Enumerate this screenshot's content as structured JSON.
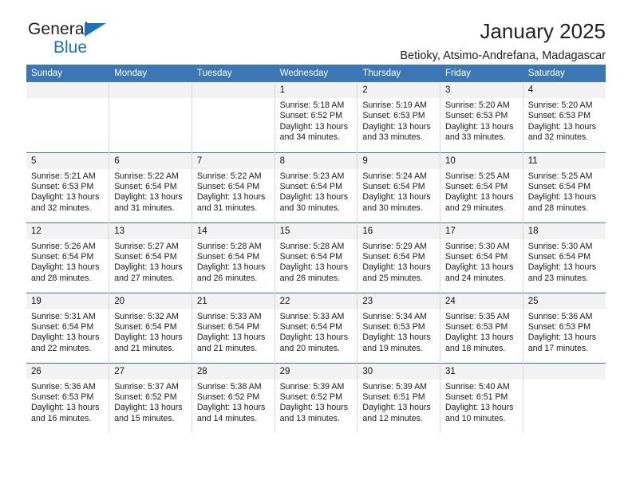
{
  "brand": {
    "name_top": "General",
    "name_bottom": "Blue",
    "accent_color": "#1d72b8"
  },
  "header": {
    "title": "January 2025",
    "subtitle": "Betioky, Atsimo-Andrefana, Madagascar"
  },
  "theme": {
    "header_bg": "#3b76b5",
    "daynum_bg": "#f2f2f2",
    "grid_line": "#d9d9d9"
  },
  "labels": {
    "sunrise_prefix": "Sunrise:",
    "sunset_prefix": "Sunset:",
    "daylight_prefix": "Daylight:"
  },
  "weekday_headers": [
    "Sunday",
    "Monday",
    "Tuesday",
    "Wednesday",
    "Thursday",
    "Friday",
    "Saturday"
  ],
  "weeks": [
    [
      {
        "day": "",
        "blank": true,
        "sunrise": "",
        "sunset": "",
        "daylight": ""
      },
      {
        "day": "",
        "blank": true,
        "sunrise": "",
        "sunset": "",
        "daylight": ""
      },
      {
        "day": "",
        "blank": true,
        "sunrise": "",
        "sunset": "",
        "daylight": ""
      },
      {
        "day": "1",
        "blank": false,
        "sunrise": "Sunrise: 5:18 AM",
        "sunset": "Sunset: 6:52 PM",
        "daylight": "Daylight: 13 hours and 34 minutes."
      },
      {
        "day": "2",
        "blank": false,
        "sunrise": "Sunrise: 5:19 AM",
        "sunset": "Sunset: 6:53 PM",
        "daylight": "Daylight: 13 hours and 33 minutes."
      },
      {
        "day": "3",
        "blank": false,
        "sunrise": "Sunrise: 5:20 AM",
        "sunset": "Sunset: 6:53 PM",
        "daylight": "Daylight: 13 hours and 33 minutes."
      },
      {
        "day": "4",
        "blank": false,
        "sunrise": "Sunrise: 5:20 AM",
        "sunset": "Sunset: 6:53 PM",
        "daylight": "Daylight: 13 hours and 32 minutes."
      }
    ],
    [
      {
        "day": "5",
        "blank": false,
        "sunrise": "Sunrise: 5:21 AM",
        "sunset": "Sunset: 6:53 PM",
        "daylight": "Daylight: 13 hours and 32 minutes."
      },
      {
        "day": "6",
        "blank": false,
        "sunrise": "Sunrise: 5:22 AM",
        "sunset": "Sunset: 6:54 PM",
        "daylight": "Daylight: 13 hours and 31 minutes."
      },
      {
        "day": "7",
        "blank": false,
        "sunrise": "Sunrise: 5:22 AM",
        "sunset": "Sunset: 6:54 PM",
        "daylight": "Daylight: 13 hours and 31 minutes."
      },
      {
        "day": "8",
        "blank": false,
        "sunrise": "Sunrise: 5:23 AM",
        "sunset": "Sunset: 6:54 PM",
        "daylight": "Daylight: 13 hours and 30 minutes."
      },
      {
        "day": "9",
        "blank": false,
        "sunrise": "Sunrise: 5:24 AM",
        "sunset": "Sunset: 6:54 PM",
        "daylight": "Daylight: 13 hours and 30 minutes."
      },
      {
        "day": "10",
        "blank": false,
        "sunrise": "Sunrise: 5:25 AM",
        "sunset": "Sunset: 6:54 PM",
        "daylight": "Daylight: 13 hours and 29 minutes."
      },
      {
        "day": "11",
        "blank": false,
        "sunrise": "Sunrise: 5:25 AM",
        "sunset": "Sunset: 6:54 PM",
        "daylight": "Daylight: 13 hours and 28 minutes."
      }
    ],
    [
      {
        "day": "12",
        "blank": false,
        "sunrise": "Sunrise: 5:26 AM",
        "sunset": "Sunset: 6:54 PM",
        "daylight": "Daylight: 13 hours and 28 minutes."
      },
      {
        "day": "13",
        "blank": false,
        "sunrise": "Sunrise: 5:27 AM",
        "sunset": "Sunset: 6:54 PM",
        "daylight": "Daylight: 13 hours and 27 minutes."
      },
      {
        "day": "14",
        "blank": false,
        "sunrise": "Sunrise: 5:28 AM",
        "sunset": "Sunset: 6:54 PM",
        "daylight": "Daylight: 13 hours and 26 minutes."
      },
      {
        "day": "15",
        "blank": false,
        "sunrise": "Sunrise: 5:28 AM",
        "sunset": "Sunset: 6:54 PM",
        "daylight": "Daylight: 13 hours and 26 minutes."
      },
      {
        "day": "16",
        "blank": false,
        "sunrise": "Sunrise: 5:29 AM",
        "sunset": "Sunset: 6:54 PM",
        "daylight": "Daylight: 13 hours and 25 minutes."
      },
      {
        "day": "17",
        "blank": false,
        "sunrise": "Sunrise: 5:30 AM",
        "sunset": "Sunset: 6:54 PM",
        "daylight": "Daylight: 13 hours and 24 minutes."
      },
      {
        "day": "18",
        "blank": false,
        "sunrise": "Sunrise: 5:30 AM",
        "sunset": "Sunset: 6:54 PM",
        "daylight": "Daylight: 13 hours and 23 minutes."
      }
    ],
    [
      {
        "day": "19",
        "blank": false,
        "sunrise": "Sunrise: 5:31 AM",
        "sunset": "Sunset: 6:54 PM",
        "daylight": "Daylight: 13 hours and 22 minutes."
      },
      {
        "day": "20",
        "blank": false,
        "sunrise": "Sunrise: 5:32 AM",
        "sunset": "Sunset: 6:54 PM",
        "daylight": "Daylight: 13 hours and 21 minutes."
      },
      {
        "day": "21",
        "blank": false,
        "sunrise": "Sunrise: 5:33 AM",
        "sunset": "Sunset: 6:54 PM",
        "daylight": "Daylight: 13 hours and 21 minutes."
      },
      {
        "day": "22",
        "blank": false,
        "sunrise": "Sunrise: 5:33 AM",
        "sunset": "Sunset: 6:54 PM",
        "daylight": "Daylight: 13 hours and 20 minutes."
      },
      {
        "day": "23",
        "blank": false,
        "sunrise": "Sunrise: 5:34 AM",
        "sunset": "Sunset: 6:53 PM",
        "daylight": "Daylight: 13 hours and 19 minutes."
      },
      {
        "day": "24",
        "blank": false,
        "sunrise": "Sunrise: 5:35 AM",
        "sunset": "Sunset: 6:53 PM",
        "daylight": "Daylight: 13 hours and 18 minutes."
      },
      {
        "day": "25",
        "blank": false,
        "sunrise": "Sunrise: 5:36 AM",
        "sunset": "Sunset: 6:53 PM",
        "daylight": "Daylight: 13 hours and 17 minutes."
      }
    ],
    [
      {
        "day": "26",
        "blank": false,
        "sunrise": "Sunrise: 5:36 AM",
        "sunset": "Sunset: 6:53 PM",
        "daylight": "Daylight: 13 hours and 16 minutes."
      },
      {
        "day": "27",
        "blank": false,
        "sunrise": "Sunrise: 5:37 AM",
        "sunset": "Sunset: 6:52 PM",
        "daylight": "Daylight: 13 hours and 15 minutes."
      },
      {
        "day": "28",
        "blank": false,
        "sunrise": "Sunrise: 5:38 AM",
        "sunset": "Sunset: 6:52 PM",
        "daylight": "Daylight: 13 hours and 14 minutes."
      },
      {
        "day": "29",
        "blank": false,
        "sunrise": "Sunrise: 5:39 AM",
        "sunset": "Sunset: 6:52 PM",
        "daylight": "Daylight: 13 hours and 13 minutes."
      },
      {
        "day": "30",
        "blank": false,
        "sunrise": "Sunrise: 5:39 AM",
        "sunset": "Sunset: 6:51 PM",
        "daylight": "Daylight: 13 hours and 12 minutes."
      },
      {
        "day": "31",
        "blank": false,
        "sunrise": "Sunrise: 5:40 AM",
        "sunset": "Sunset: 6:51 PM",
        "daylight": "Daylight: 13 hours and 10 minutes."
      },
      {
        "day": "",
        "blank": true,
        "sunrise": "",
        "sunset": "",
        "daylight": ""
      }
    ]
  ]
}
